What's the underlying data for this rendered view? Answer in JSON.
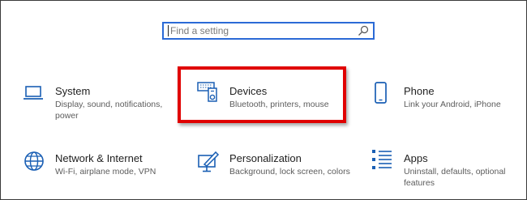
{
  "search": {
    "placeholder": "Find a setting"
  },
  "tiles": [
    {
      "title": "System",
      "desc": "Display, sound, notifications, power",
      "icon": "laptop-icon"
    },
    {
      "title": "Devices",
      "desc": "Bluetooth, printers, mouse",
      "icon": "devices-icon"
    },
    {
      "title": "Phone",
      "desc": "Link your Android, iPhone",
      "icon": "phone-icon"
    },
    {
      "title": "Network & Internet",
      "desc": "Wi-Fi, airplane mode, VPN",
      "icon": "globe-icon"
    },
    {
      "title": "Personalization",
      "desc": "Background, lock screen, colors",
      "icon": "personalization-icon"
    },
    {
      "title": "Apps",
      "desc": "Uninstall, defaults, optional features",
      "icon": "apps-list-icon"
    }
  ],
  "colors": {
    "accent": "#2b6ad6",
    "icon": "#1a5fb4",
    "highlight": "#e00000"
  }
}
